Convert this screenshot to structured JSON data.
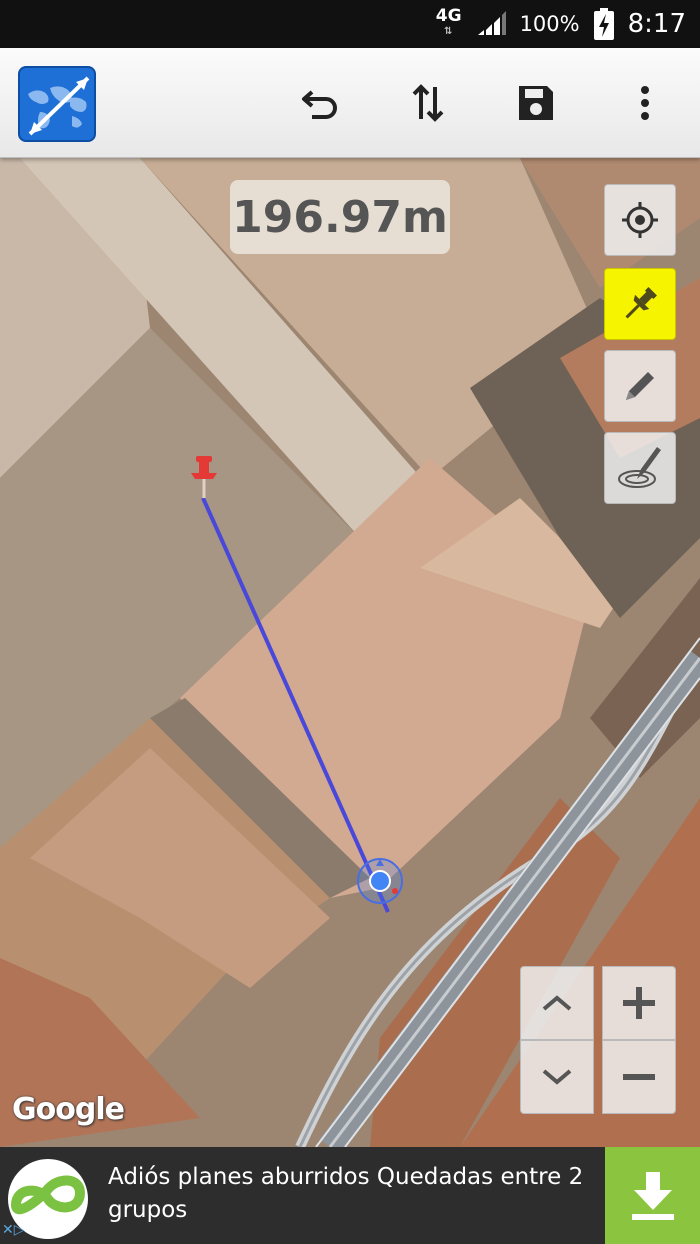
{
  "status_bar": {
    "network": "4G",
    "network_activity": "⇅",
    "battery": "100%",
    "time": "8:17"
  },
  "toolbar": {
    "app_icon": "world-map-ruler-icon",
    "actions": [
      {
        "name": "undo",
        "icon": "undo-icon"
      },
      {
        "name": "swap",
        "icon": "swap-vertical-icon"
      },
      {
        "name": "save",
        "icon": "save-icon"
      },
      {
        "name": "overflow",
        "icon": "more-vert-icon"
      }
    ]
  },
  "map": {
    "distance": "196.97m",
    "attribution": "Google",
    "tools": [
      {
        "name": "my-location",
        "icon": "crosshair-icon",
        "active": false
      },
      {
        "name": "pin-mode",
        "icon": "pushpin-icon",
        "active": true
      },
      {
        "name": "draw-mode",
        "icon": "pencil-icon",
        "active": false
      },
      {
        "name": "area-mode",
        "icon": "area-pen-icon",
        "active": false
      }
    ],
    "nav": {
      "up": "chevron-up-icon",
      "down": "chevron-down-icon",
      "zoom_in": "+",
      "zoom_out": "−"
    }
  },
  "ad": {
    "text": "Adiós planes aburridos Quedadas entre 2 grupos",
    "download_icon": "download-icon"
  },
  "colors": {
    "active_tool": "#f7f400",
    "measure_line": "#4a48d8",
    "pin": "#e53935",
    "ad_button": "#8bc53f"
  }
}
